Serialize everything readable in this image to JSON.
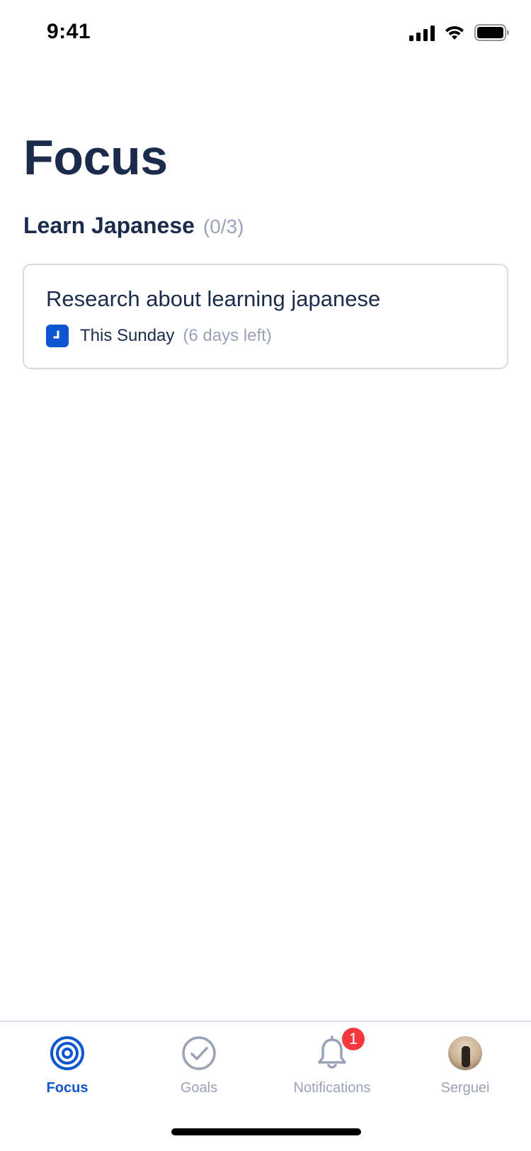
{
  "status_bar": {
    "time": "9:41"
  },
  "page": {
    "title": "Focus"
  },
  "goal": {
    "title": "Learn Japanese",
    "progress": "(0/3)",
    "tasks": [
      {
        "title": "Research about learning japanese",
        "due": "This Sunday",
        "remaining": "(6 days left)"
      }
    ]
  },
  "tab_bar": {
    "tabs": [
      {
        "label": "Focus",
        "icon": "target-icon",
        "active": true
      },
      {
        "label": "Goals",
        "icon": "check-circle-icon",
        "active": false
      },
      {
        "label": "Notifications",
        "icon": "bell-icon",
        "badge": "1",
        "active": false
      },
      {
        "label": "Serguei",
        "icon": "avatar",
        "active": false
      }
    ]
  },
  "colors": {
    "primary": "#0e56d0",
    "heading": "#1a2b4c",
    "muted": "#9aa3b5",
    "badge": "#f5383d"
  }
}
